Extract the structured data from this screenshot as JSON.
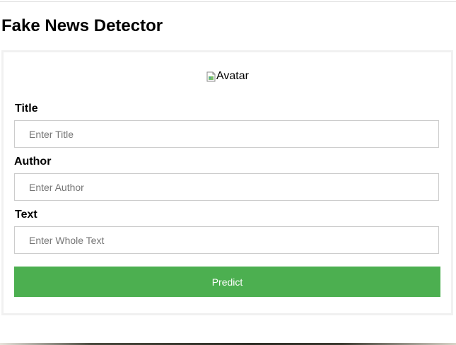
{
  "page": {
    "title": "Fake News Detector"
  },
  "form": {
    "avatar_alt": "Avatar",
    "title_label": "Title",
    "title_placeholder": "Enter Title",
    "author_label": "Author",
    "author_placeholder": "Enter Author",
    "text_label": "Text",
    "text_placeholder": "Enter Whole Text",
    "predict_label": "Predict"
  },
  "icons": {
    "avatar": "broken-image-icon"
  },
  "colors": {
    "accent": "#4caf50",
    "button_text": "#ffffff",
    "card_border": "#f1f1f1",
    "input_border": "#cccccc"
  }
}
